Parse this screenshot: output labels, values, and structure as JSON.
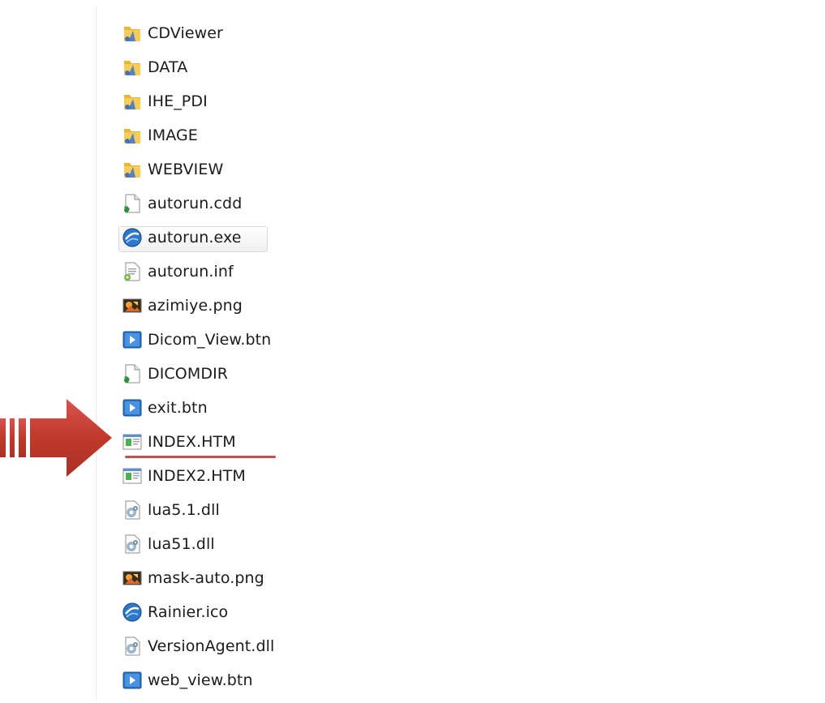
{
  "items": [
    {
      "name": "CDViewer",
      "icon": "folder-icon"
    },
    {
      "name": "DATA",
      "icon": "folder-icon"
    },
    {
      "name": "IHE_PDI",
      "icon": "folder-icon"
    },
    {
      "name": "IMAGE",
      "icon": "folder-icon"
    },
    {
      "name": "WEBVIEW",
      "icon": "folder-icon"
    },
    {
      "name": "autorun.cdd",
      "icon": "file-icon"
    },
    {
      "name": "autorun.exe",
      "icon": "app-icon",
      "selected": true
    },
    {
      "name": "autorun.inf",
      "icon": "settings-file-icon"
    },
    {
      "name": "azimiye.png",
      "icon": "image-file-icon"
    },
    {
      "name": "Dicom_View.btn",
      "icon": "btn-file-icon"
    },
    {
      "name": "DICOMDIR",
      "icon": "file-icon"
    },
    {
      "name": "exit.btn",
      "icon": "btn-file-icon"
    },
    {
      "name": "INDEX.HTM",
      "icon": "html-file-icon",
      "underlined": true
    },
    {
      "name": "INDEX2.HTM",
      "icon": "html-file-icon"
    },
    {
      "name": "lua5.1.dll",
      "icon": "dll-file-icon"
    },
    {
      "name": "lua51.dll",
      "icon": "dll-file-icon"
    },
    {
      "name": "mask-auto.png",
      "icon": "image-file-icon"
    },
    {
      "name": "Rainier.ico",
      "icon": "app-icon"
    },
    {
      "name": "VersionAgent.dll",
      "icon": "dll-file-icon"
    },
    {
      "name": "web_view.btn",
      "icon": "btn-file-icon"
    }
  ],
  "colors": {
    "arrow": "#c0504d",
    "underline": "#c0504d",
    "text": "#1b1b1b"
  }
}
